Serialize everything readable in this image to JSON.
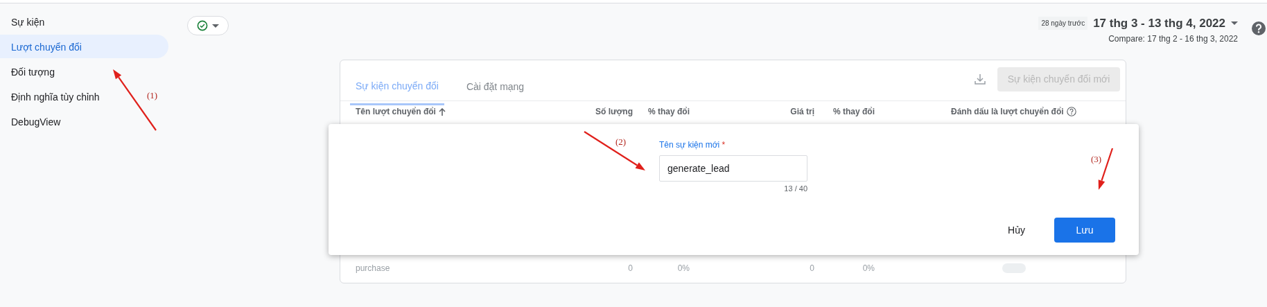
{
  "sidebar": {
    "items": [
      {
        "label": "Sự kiện",
        "selected": false
      },
      {
        "label": "Lượt chuyển đổi",
        "selected": true
      },
      {
        "label": "Đối tượng",
        "selected": false
      },
      {
        "label": "Định nghĩa tùy chỉnh",
        "selected": false
      },
      {
        "label": "DebugView",
        "selected": false
      }
    ]
  },
  "date_range": {
    "preset": "28 ngày trước",
    "range": "17 thg 3 - 13 thg 4, 2022",
    "compare": "Compare: 17 thg 2 - 16 thg 3, 2022"
  },
  "card": {
    "tabs": [
      {
        "label": "Sự kiện chuyển đổi",
        "selected": true
      },
      {
        "label": "Cài đặt mạng",
        "selected": false
      }
    ],
    "new_button": {
      "label": "Sự kiện chuyển đổi mới",
      "disabled": true
    },
    "table": {
      "columns": [
        {
          "label": "Tên lượt chuyển đổi",
          "sorted_ascending": true
        },
        {
          "label": "Số lượng"
        },
        {
          "label": "% thay đổi"
        },
        {
          "label": "Giá trị"
        },
        {
          "label": "% thay đổi"
        },
        {
          "label": "Đánh dấu là lượt chuyển đổi",
          "help": true
        }
      ],
      "rows": [
        {
          "name": "purchase",
          "count": "0",
          "count_change": "0%",
          "value": "0",
          "value_change": "0%",
          "marked": false
        }
      ]
    }
  },
  "dialog": {
    "label": "Tên sự kiện mới",
    "required_mark": "*",
    "value": "generate_lead",
    "counter": "13 / 40",
    "buttons": [
      {
        "label": "Hủy",
        "kind": "text"
      },
      {
        "label": "Lưu",
        "kind": "primary"
      }
    ]
  },
  "annotations": [
    {
      "label": "(1)"
    },
    {
      "label": "(2)"
    },
    {
      "label": "(3)"
    }
  ]
}
